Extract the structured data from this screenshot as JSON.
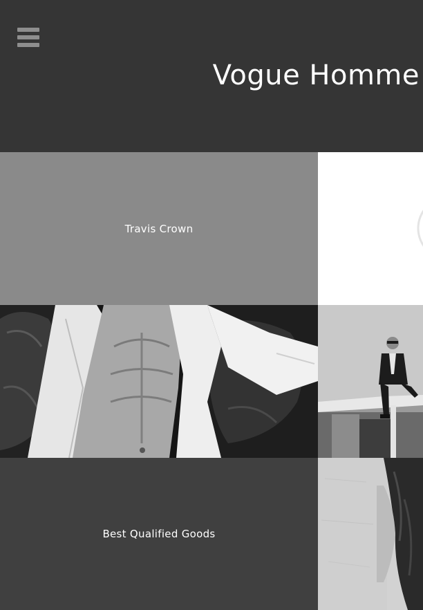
{
  "header": {
    "brand_title": "Vogue Homme",
    "menu_icon": "hamburger-menu-icon"
  },
  "tiles": [
    {
      "label": "Travis Crown",
      "kind": "text-tile",
      "background": "#8a8a8a"
    },
    {
      "kind": "image-tile",
      "image": "white-circle-partial"
    },
    {
      "kind": "image-tile",
      "image": "man-open-white-shirt-on-leather-sofa"
    },
    {
      "kind": "image-tile",
      "image": "man-in-suit-sitting-on-rooftop-ledge"
    },
    {
      "label": "Best Qualified Goods",
      "kind": "text-tile",
      "background": "#404040"
    },
    {
      "kind": "image-tile",
      "image": "woman-portrait-closeup"
    }
  ],
  "colors": {
    "header_bg": "#353535",
    "menu_icon": "#8e8e8e",
    "title_text": "#ffffff"
  }
}
